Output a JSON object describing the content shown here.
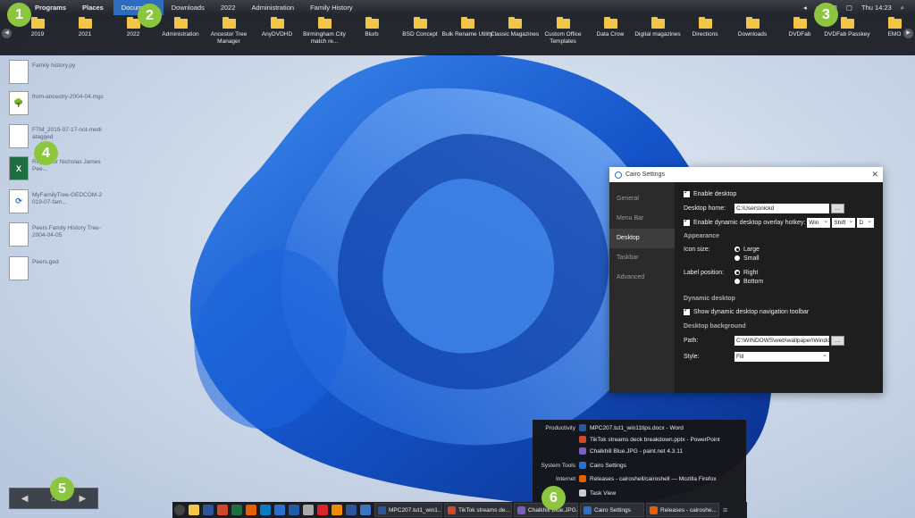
{
  "menubar": {
    "items": [
      "Programs",
      "Places",
      "Documents",
      "Downloads",
      "2022",
      "Administration",
      "Family History"
    ],
    "clock": "Thu 14:23"
  },
  "folders": [
    "2019",
    "2021",
    "2022",
    "Administration",
    "Ancestor Tree Manager",
    "AnyDVDHD",
    "Birmingham City match re...",
    "Blurb",
    "BSD Concept",
    "Bulk Rename Utility",
    "Classic Magazines",
    "Custom Office Templates",
    "Data Crow",
    "Digital magazines",
    "Directions",
    "Downloads",
    "DVDFab",
    "DVDFab Passkey",
    "EMO"
  ],
  "desktop_icons": [
    {
      "label": "Family history.py",
      "glyph": ""
    },
    {
      "label": "from-ancestry-2004-04.mgc",
      "glyph": "🌳"
    },
    {
      "label": "FTM_2019-07-17-not-mediatagged",
      "glyph": "▦"
    },
    {
      "label": "Report for Nicholas James Pee...",
      "glyph": "X"
    },
    {
      "label": "MyFamilyTree-GEDCOM-2019-07-fam...",
      "glyph": "⟳"
    },
    {
      "label": "Peers Family History Tree-2004-04-05",
      "glyph": ""
    },
    {
      "label": "Peers.ged",
      "glyph": ""
    }
  ],
  "settings": {
    "title": "Cairo Settings",
    "nav": [
      "General",
      "Menu Bar",
      "Desktop",
      "Taskbar",
      "Advanced"
    ],
    "enable_desktop": "Enable desktop",
    "desktop_home_label": "Desktop home:",
    "desktop_home_value": "C:\\Users\\nickd",
    "browse": "...",
    "hotkey_label": "Enable dynamic desktop overlay hotkey:",
    "hotkey": [
      "Win",
      "Shift",
      "D"
    ],
    "appearance": "Appearance",
    "icon_size_label": "Icon size:",
    "icon_size_opts": [
      "Large",
      "Small"
    ],
    "label_pos_label": "Label position:",
    "label_pos_opts": [
      "Right",
      "Bottom"
    ],
    "dynamic_desktop": "Dynamic desktop",
    "show_toolbar": "Show dynamic desktop navigation toolbar",
    "desktop_bg": "Desktop background",
    "path_label": "Path:",
    "path_value": "C:\\WINDOWS\\web\\wallpaper\\Windo",
    "style_label": "Style:",
    "style_value": "Fill"
  },
  "programs_menu": [
    {
      "cat": "Productivity",
      "text": "MPC207.tut1_win11tips.docx - Word",
      "color": "#2b579a"
    },
    {
      "cat": "",
      "text": "TikTok streams deck breakdown.pptx - PowerPoint",
      "color": "#d24726"
    },
    {
      "cat": "",
      "text": "Chalkhill Blue.JPG - paint.net 4.3.11",
      "color": "#7a5dbd"
    },
    {
      "cat": "System Tools",
      "text": "Cairo Settings",
      "color": "#2a72c9"
    },
    {
      "cat": "Internet",
      "text": "Releases - cairoshell/cairoshell — Mozilla Firefox",
      "color": "#e66000"
    },
    {
      "cat": "",
      "text": "Task View",
      "color": "#cccccc"
    }
  ],
  "taskbar": {
    "pinned_colors": [
      "#555",
      "#f3c647",
      "#2b579a",
      "#d24726",
      "#1d6f42",
      "#e66000",
      "#0a7cc5",
      "#2b6fd0",
      "#1e5ba8",
      "#aaaaaa",
      "#d9252b",
      "#f08a00",
      "#2b579a",
      "#3a75c4"
    ],
    "windows": [
      "MPC207.tut1_win1...",
      "TikTok streams de...",
      "Chalkhill Blue.JPG...",
      "Cairo Settings",
      "Releases - cairoshe..."
    ]
  },
  "badges": [
    "1",
    "2",
    "3",
    "4",
    "5",
    "6"
  ]
}
